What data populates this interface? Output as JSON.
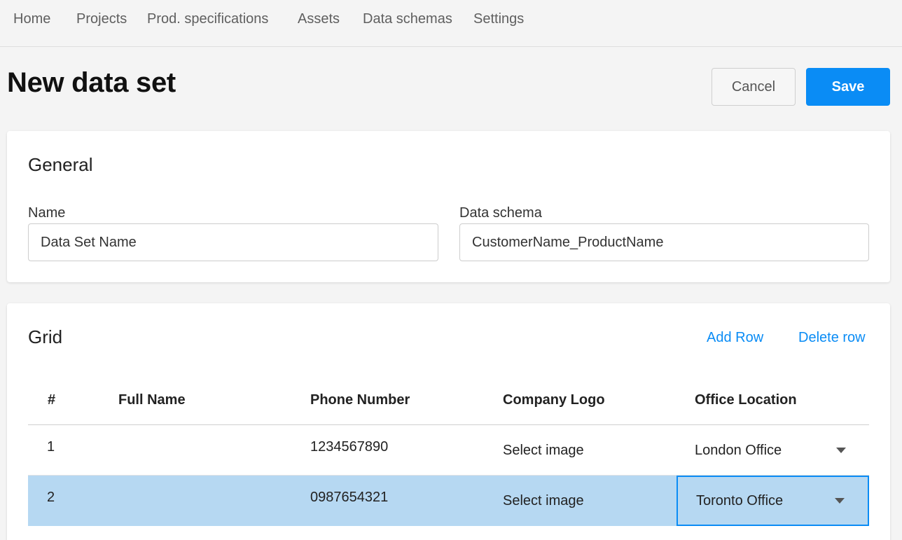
{
  "nav": {
    "items": [
      "Home",
      "Projects",
      "Prod. specifications",
      "Assets",
      "Data schemas",
      "Settings"
    ]
  },
  "header": {
    "title": "New data set",
    "cancel_label": "Cancel",
    "save_label": "Save"
  },
  "general": {
    "title": "General",
    "name_label": "Name",
    "name_value": "Data Set Name",
    "schema_label": "Data schema",
    "schema_value": "CustomerName_ProductName"
  },
  "grid": {
    "title": "Grid",
    "add_row_label": "Add Row",
    "delete_row_label": "Delete row",
    "columns": [
      "#",
      "Full Name",
      "Phone Number",
      "Company Logo",
      "Office Location"
    ],
    "rows": [
      {
        "num": "1",
        "full_name": "",
        "phone": "1234567890",
        "logo": "Select image",
        "office": "London Office"
      },
      {
        "num": "2",
        "full_name": "",
        "phone": "0987654321",
        "logo": "Select image",
        "office": "Toronto Office"
      }
    ],
    "selected_row": "2"
  },
  "colors": {
    "accent": "#0a8cf5",
    "selected_row_bg": "#b6d8f2"
  }
}
